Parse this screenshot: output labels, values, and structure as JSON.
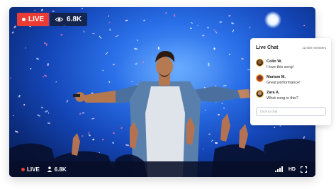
{
  "stream": {
    "live_label": "LIVE",
    "viewer_count": "6.8K"
  },
  "controls": {
    "live_label": "LIVE",
    "viewer_count": "6.8K",
    "quality": "HD"
  },
  "chat": {
    "title": "Live Chat",
    "members": "12,000 members",
    "input_placeholder": "Click to chat",
    "messages": [
      {
        "name": "Colin W.",
        "text": "I love this song!"
      },
      {
        "name": "Mariam M.",
        "text": "Great performance!"
      },
      {
        "name": "Zara A.",
        "text": "What song is this?"
      }
    ]
  },
  "colors": {
    "live_red": "#ea3b34",
    "avatar_ring": "#f2b232"
  }
}
